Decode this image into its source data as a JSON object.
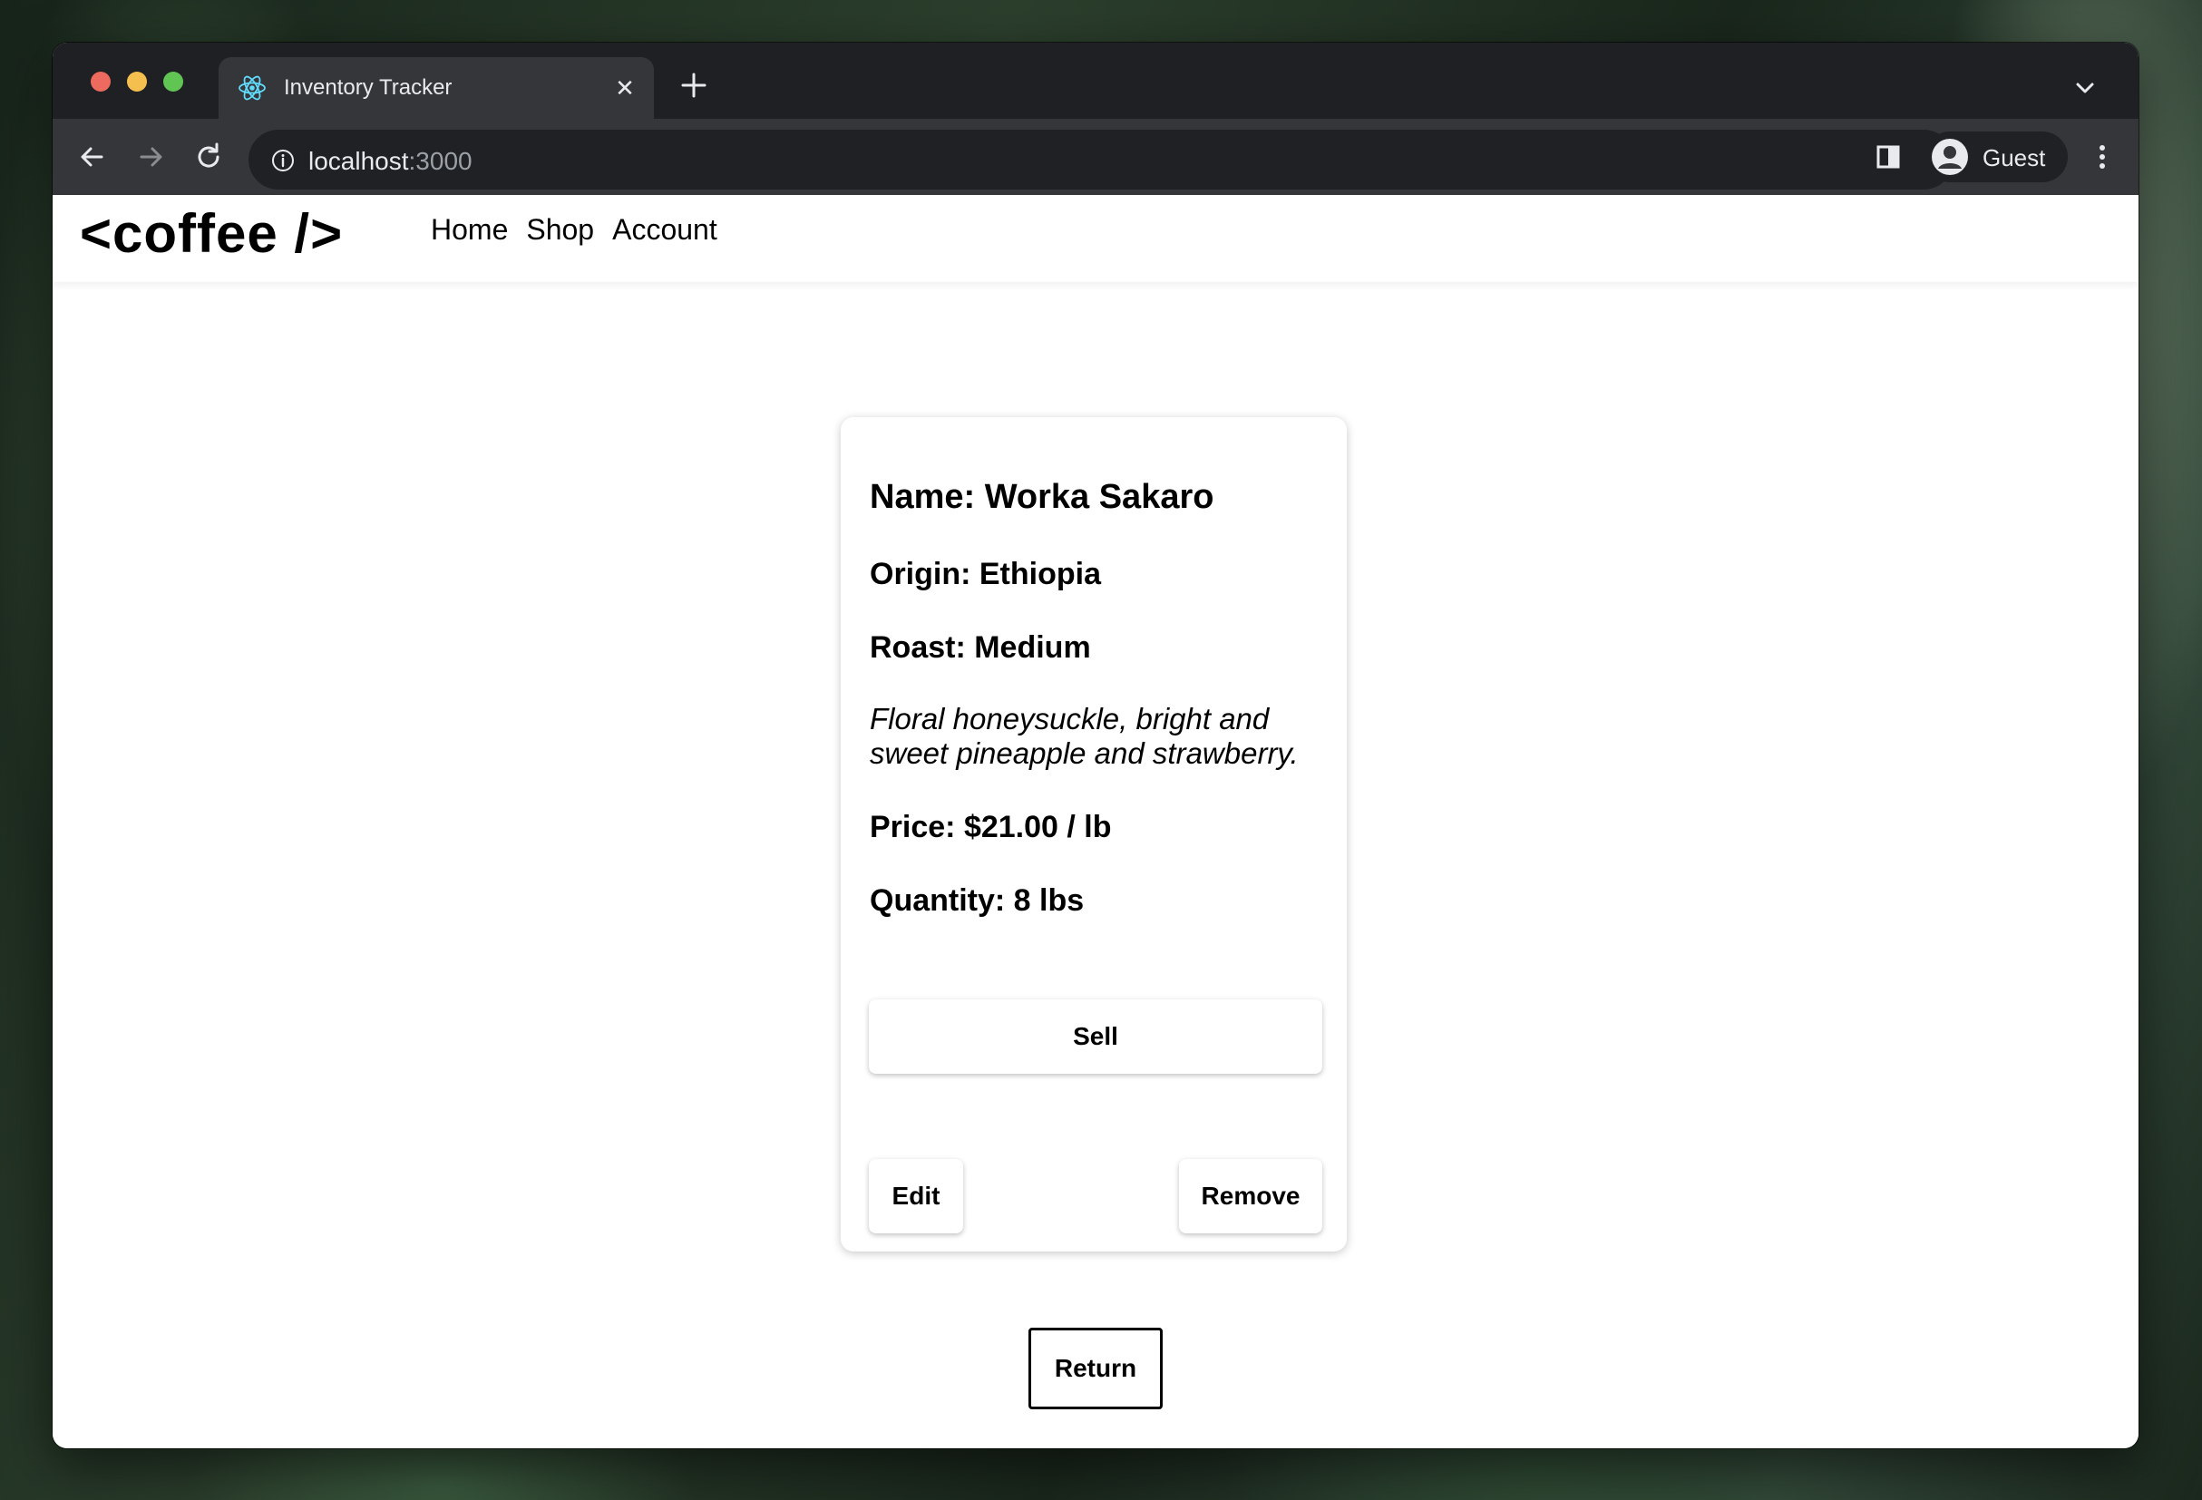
{
  "browser": {
    "tab_title": "Inventory Tracker",
    "url_host": "localhost",
    "url_port": ":3000",
    "profile_name": "Guest"
  },
  "site": {
    "logo": "<coffee />",
    "nav": [
      "Home",
      "Shop",
      "Account"
    ]
  },
  "product": {
    "name": "Name: Worka Sakaro",
    "origin": "Origin: Ethiopia",
    "roast": "Roast: Medium",
    "description": "Floral honeysuckle, bright and sweet pineapple and strawberry.",
    "price": "Price: $21.00 / lb",
    "quantity": "Quantity: 8 lbs"
  },
  "actions": {
    "sell": "Sell",
    "edit": "Edit",
    "remove": "Remove",
    "return": "Return"
  },
  "icons": {
    "favicon": "react-atom-icon",
    "close": "close-icon",
    "new_tab": "plus-icon",
    "back": "arrow-left-icon",
    "forward": "arrow-right-icon",
    "reload": "reload-icon",
    "info": "info-icon",
    "side_panel": "side-panel-icon",
    "avatar": "avatar-icon",
    "menu": "kebab-menu-icon",
    "tab_list": "chevron-down-icon"
  },
  "colors": {
    "tabbar_bg": "#1f2023",
    "toolbar_bg": "#35363a",
    "omnibox_bg": "#202124",
    "react_blue": "#61dafb"
  }
}
